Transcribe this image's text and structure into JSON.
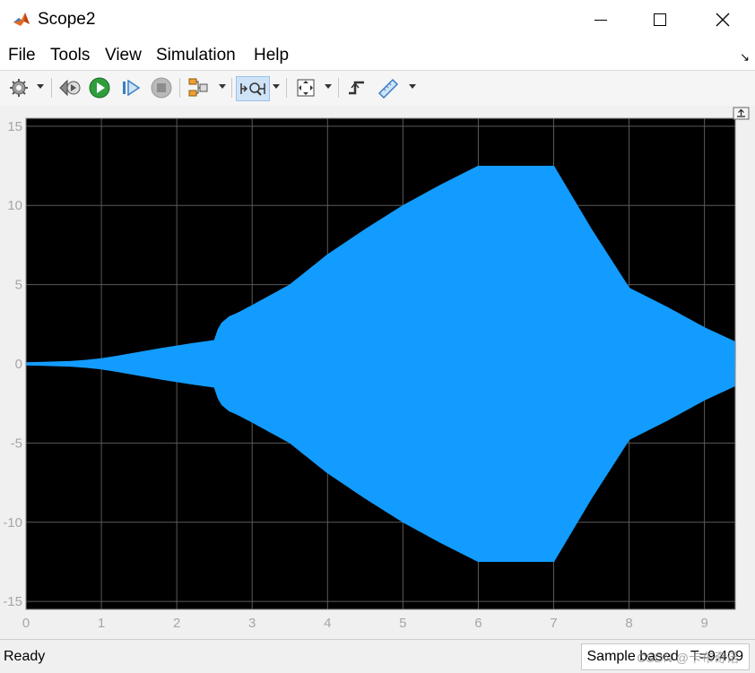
{
  "window": {
    "title": "Scope2",
    "icon": "matlab-logo-icon",
    "controls": [
      "minimize-icon",
      "maximize-icon",
      "close-icon"
    ]
  },
  "menu": {
    "items": [
      "File",
      "Tools",
      "View",
      "Simulation",
      "Help"
    ]
  },
  "toolbar": {
    "icons": [
      "settings-gear-icon",
      "step-back-icon",
      "run-icon",
      "step-forward-icon",
      "stop-icon",
      "signal-selector-icon",
      "zoom-autoscale-icon",
      "fit-to-view-icon",
      "triggers-icon",
      "measurements-icon"
    ],
    "active": "zoom-autoscale-icon"
  },
  "colors": {
    "plot_background": "#000000",
    "signal": "#139cff",
    "grid": "#5a5a5a",
    "axes_text": "#a6a6a6"
  },
  "chart_data": {
    "type": "line",
    "title": "",
    "xlabel": "",
    "ylabel": "",
    "xlim": [
      0,
      9.409
    ],
    "ylim": [
      -15.5,
      15.5
    ],
    "xticks": [
      "0",
      "1",
      "2",
      "3",
      "4",
      "5",
      "6",
      "7",
      "8",
      "9"
    ],
    "yticks": [
      "15",
      "10",
      "5",
      "0",
      "-5",
      "-10",
      "-15"
    ],
    "grid": true,
    "series": [
      {
        "envelope": {
          "x": [
            0,
            0.2,
            0.4,
            0.6,
            0.8,
            1.0,
            1.2,
            1.5,
            1.8,
            2.0,
            2.2,
            2.5,
            2.55,
            2.6,
            2.7,
            2.8,
            3.0,
            3.5,
            4.0,
            4.5,
            5.0,
            5.5,
            6.0,
            6.5,
            7.0,
            7.5,
            8.0,
            8.5,
            9.0,
            9.409
          ],
          "upper": [
            0.1,
            0.12,
            0.15,
            0.18,
            0.25,
            0.35,
            0.5,
            0.75,
            1.0,
            1.15,
            1.3,
            1.5,
            2.2,
            2.6,
            3.0,
            3.2,
            3.7,
            5.0,
            6.9,
            8.5,
            10.0,
            11.3,
            12.5,
            12.5,
            12.5,
            8.5,
            4.8,
            3.6,
            2.3,
            1.4
          ],
          "lower": [
            -0.1,
            -0.12,
            -0.15,
            -0.18,
            -0.25,
            -0.35,
            -0.5,
            -0.75,
            -1.0,
            -1.15,
            -1.3,
            -1.5,
            -2.2,
            -2.6,
            -3.0,
            -3.2,
            -3.7,
            -5.0,
            -6.9,
            -8.5,
            -10.0,
            -11.3,
            -12.5,
            -12.5,
            -12.5,
            -8.5,
            -4.8,
            -3.6,
            -2.3,
            -1.4
          ]
        }
      }
    ]
  },
  "status": {
    "state": "Ready",
    "info": "Sample based   T=9.409",
    "watermark": "CSDN @卡布奇诺"
  }
}
